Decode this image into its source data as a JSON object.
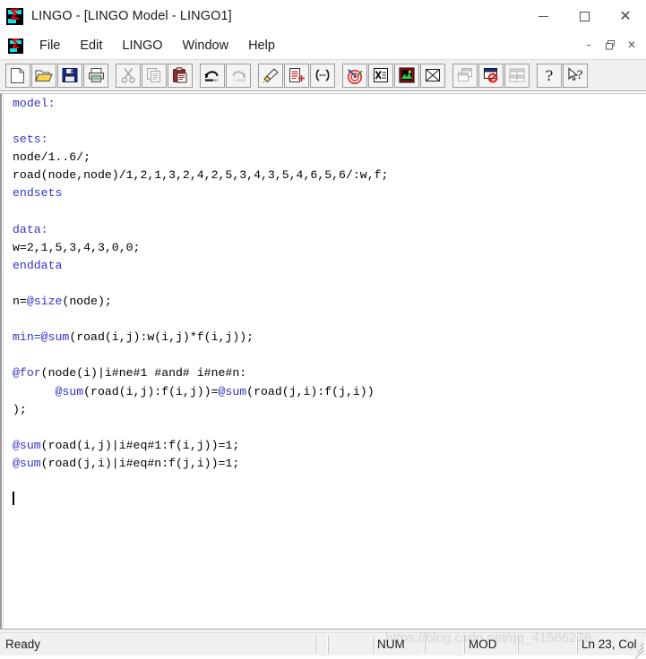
{
  "window": {
    "title": "LINGO - [LINGO Model - LINGO1]",
    "app_icon": "lingo-sigma-icon",
    "controls": {
      "minimize": "—",
      "maximize": "□",
      "close": "✕"
    }
  },
  "menubar": {
    "icon": "lingo-sigma-icon",
    "items": [
      {
        "label": "File"
      },
      {
        "label": "Edit"
      },
      {
        "label": "LINGO"
      },
      {
        "label": "Window"
      },
      {
        "label": "Help"
      }
    ],
    "mdi_controls": {
      "minimize": "–",
      "restore": "❐",
      "close": "✕"
    }
  },
  "toolbar": {
    "groups": [
      {
        "buttons": [
          {
            "name": "new-document-button",
            "icon": "new-document-icon",
            "enabled": true
          },
          {
            "name": "open-folder-button",
            "icon": "open-folder-icon",
            "enabled": true
          },
          {
            "name": "save-button",
            "icon": "floppy-disk-save-icon",
            "enabled": true
          },
          {
            "name": "print-button",
            "icon": "printer-icon",
            "enabled": true
          }
        ]
      },
      {
        "buttons": [
          {
            "name": "cut-button",
            "icon": "scissors-cut-icon",
            "enabled": false
          },
          {
            "name": "copy-button",
            "icon": "copy-pages-icon",
            "enabled": false
          },
          {
            "name": "paste-button",
            "icon": "clipboard-paste-icon",
            "enabled": true
          }
        ]
      },
      {
        "buttons": [
          {
            "name": "undo-button",
            "icon": "undo-arrow-icon",
            "enabled": true
          },
          {
            "name": "redo-button",
            "icon": "redo-arrow-icon",
            "enabled": false
          }
        ]
      },
      {
        "buttons": [
          {
            "name": "find-button",
            "icon": "flashlight-find-icon",
            "enabled": true
          },
          {
            "name": "insert-new-page-button",
            "icon": "document-plus-icon",
            "enabled": true
          },
          {
            "name": "match-parenthesis-button",
            "icon": "parenthesis-match-icon",
            "enabled": true
          }
        ]
      },
      {
        "buttons": [
          {
            "name": "solve-button",
            "icon": "red-bullseye-target-icon",
            "enabled": true
          },
          {
            "name": "solution-report-button",
            "icon": "x-document-icon",
            "enabled": true
          },
          {
            "name": "picture-button",
            "icon": "model-picture-icon",
            "enabled": true
          },
          {
            "name": "debug-button",
            "icon": "crossed-box-icon",
            "enabled": true
          }
        ]
      },
      {
        "buttons": [
          {
            "name": "cascade-windows-button",
            "icon": "cascade-windows-icon",
            "enabled": false
          },
          {
            "name": "close-all-windows-button",
            "icon": "window-close-all-icon",
            "enabled": true
          },
          {
            "name": "tile-windows-button",
            "icon": "tile-windows-icon",
            "enabled": false
          }
        ]
      },
      {
        "buttons": [
          {
            "name": "help-button",
            "icon": "question-mark-help-icon",
            "enabled": true
          },
          {
            "name": "context-help-button",
            "icon": "arrow-question-help-icon",
            "enabled": true
          }
        ]
      }
    ]
  },
  "editor": {
    "lines": [
      [
        {
          "t": "model:",
          "k": true
        }
      ],
      [],
      [
        {
          "t": "sets:",
          "k": true
        }
      ],
      [
        {
          "t": "node/1..6/;",
          "k": false
        }
      ],
      [
        {
          "t": "road(node,node)/1,2,1,3,2,4,2,5,3,4,3,5,4,6,5,6/:w,f;",
          "k": false
        }
      ],
      [
        {
          "t": "endsets",
          "k": true
        }
      ],
      [],
      [
        {
          "t": "data:",
          "k": true
        }
      ],
      [
        {
          "t": "w=2,1,5,3,4,3,0,0;",
          "k": false
        }
      ],
      [
        {
          "t": "enddata",
          "k": true
        }
      ],
      [],
      [
        {
          "t": "n=",
          "k": false
        },
        {
          "t": "@size",
          "k": true
        },
        {
          "t": "(node);",
          "k": false
        }
      ],
      [],
      [
        {
          "t": "min=",
          "k": true
        },
        {
          "t": "@sum",
          "k": true
        },
        {
          "t": "(road(i,j):w(i,j)*f(i,j));",
          "k": false
        }
      ],
      [],
      [
        {
          "t": "@for",
          "k": true
        },
        {
          "t": "(node(i)|i#ne#1 #and# i#ne#n:",
          "k": false
        }
      ],
      [
        {
          "t": "      ",
          "k": false
        },
        {
          "t": "@sum",
          "k": true
        },
        {
          "t": "(road(i,j):f(i,j))=",
          "k": false
        },
        {
          "t": "@sum",
          "k": true
        },
        {
          "t": "(road(j,i):f(j,i))",
          "k": false
        }
      ],
      [
        {
          "t": ");",
          "k": false
        }
      ],
      [],
      [
        {
          "t": "@sum",
          "k": true
        },
        {
          "t": "(road(i,j)|i#eq#1:f(i,j))=1;",
          "k": false
        }
      ],
      [
        {
          "t": "@sum",
          "k": true
        },
        {
          "t": "(road(j,i)|i#eq#n:f(j,i))=1;",
          "k": false
        }
      ],
      [],
      [
        {
          "t": "__CARET__",
          "k": false
        }
      ]
    ],
    "keyword_color": "#3333CC",
    "text_color": "#000000",
    "background_color": "#FFFFFF"
  },
  "statusbar": {
    "message": "Ready",
    "blank_a": "",
    "blank_b": "",
    "num_indicator": "NUM",
    "blank_c": "",
    "mod_indicator": "MOD",
    "blank_d": "",
    "cursor_position": "Ln 23, Col"
  },
  "watermark": {
    "text": "https://blog.csdn.net/qq_41566276"
  }
}
